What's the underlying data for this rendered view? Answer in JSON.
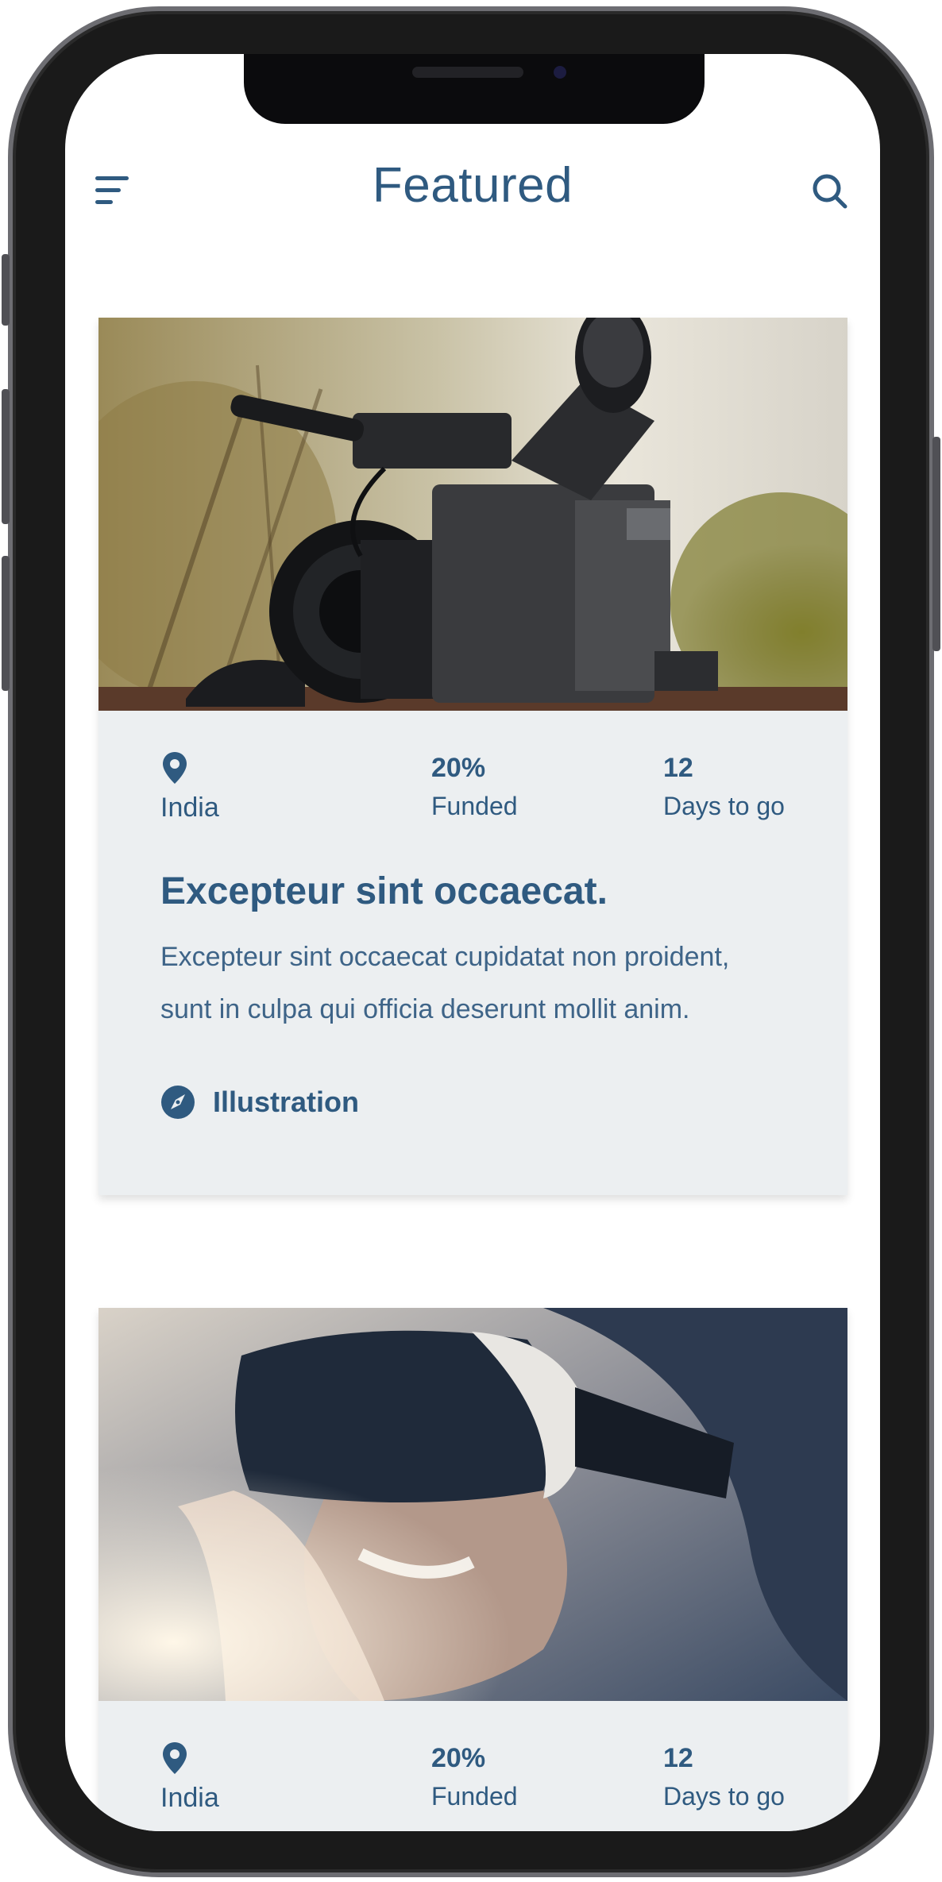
{
  "header": {
    "title": "Featured",
    "menu_icon": "hamburger-menu-icon",
    "search_icon": "search-icon"
  },
  "colors": {
    "primary_text": "#2f5a80",
    "card_background": "#eceff1",
    "page_background": "#ffffff"
  },
  "cards": [
    {
      "image": "video-camera-photo",
      "location": "India",
      "funded_value": "20%",
      "funded_label": "Funded",
      "days_value": "12",
      "days_label": "Days to go",
      "title": "Excepteur sint occaecat.",
      "description": "Excepteur sint occaecat cupidatat non proident, sunt in culpa qui officia deserunt mollit anim.",
      "category": "Illustration",
      "category_icon": "compass-icon"
    },
    {
      "image": "vr-headset-photo",
      "location": "India",
      "funded_value": "20%",
      "funded_label": "Funded",
      "days_value": "12",
      "days_label": "Days to go"
    }
  ]
}
